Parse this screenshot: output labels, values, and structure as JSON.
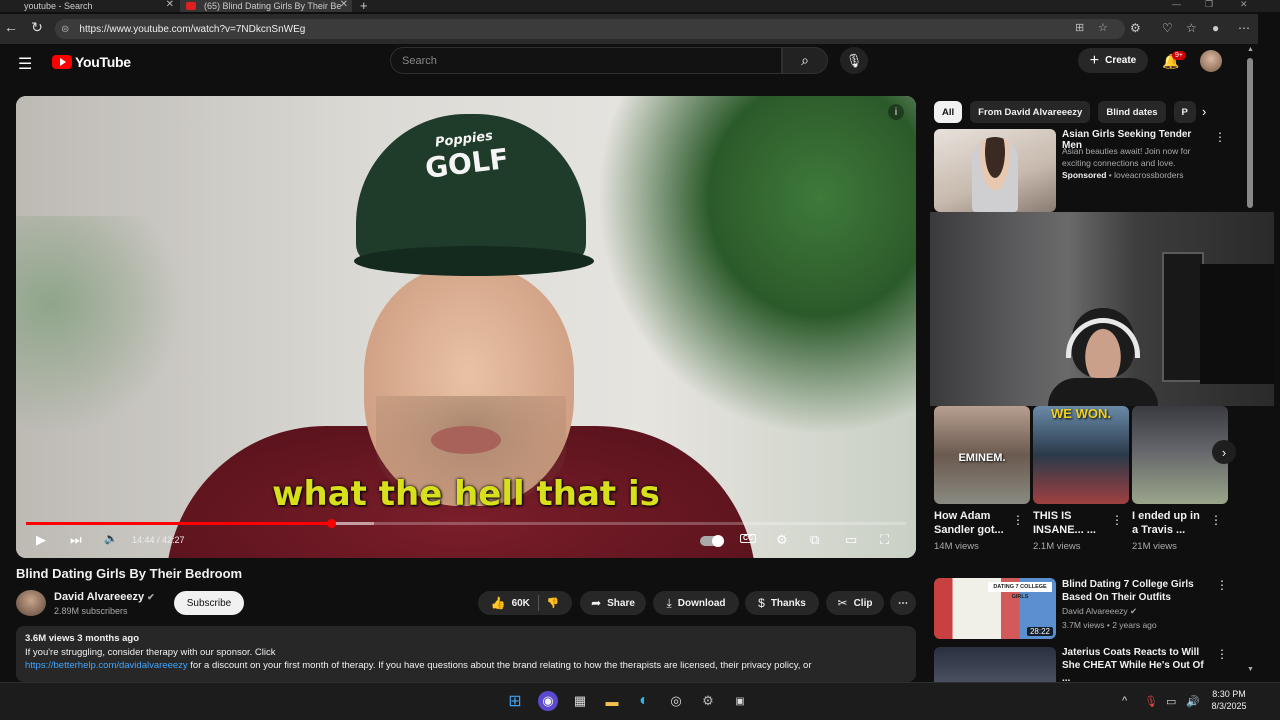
{
  "browser": {
    "tabs": [
      {
        "label": "youtube - Search"
      },
      {
        "label": "(65) Blind Dating Girls By Their Be"
      }
    ],
    "url": "https://www.youtube.com/watch?v=7NDkcnSnWEg"
  },
  "header": {
    "logo_text": "YouTube",
    "search_placeholder": "Search",
    "create_label": "Create",
    "notification_badge": "9+"
  },
  "player": {
    "subtitle": "what the hell that is",
    "cap_logo_top": "Poppies",
    "cap_logo_main": "GOLF",
    "current_time": "14:44",
    "duration": "42:27",
    "time_display": "14:44 / 42:27",
    "progress_fraction": 0.347,
    "buffered_fraction": 0.395
  },
  "video": {
    "title": "Blind Dating Girls By Their Bedroom",
    "channel_name": "David Alvareeezy",
    "subscribers": "2.89M subscribers",
    "subscribe_label": "Subscribe",
    "likes": "60K",
    "share_label": "Share",
    "download_label": "Download",
    "thanks_label": "Thanks",
    "clip_label": "Clip"
  },
  "description": {
    "meta": "3.6M views  3 months ago",
    "line1": "If you're struggling, consider therapy with our sponsor. Click",
    "link": "https://betterhelp.com/davidalvareeezy",
    "line2": " for a discount on your first month of therapy. If you have questions about the brand relating to how the therapists are licensed, their privacy policy, or"
  },
  "sidebar": {
    "chips": [
      "All",
      "From David Alvareeezy",
      "Blind dates",
      "P"
    ],
    "ad": {
      "title": "Asian Girls Seeking Tender Men",
      "desc": "Asian beauties await! Join now for exciting connections and love.",
      "sponsored": "Sponsored",
      "advertiser": "loveacrossborders"
    },
    "shorts": [
      {
        "title": "How Adam Sandler got...",
        "views": "14M views",
        "overlay": "EMINEM."
      },
      {
        "title": "THIS IS INSANE... ...",
        "views": "2.1M views",
        "overlay": "WE WON."
      },
      {
        "title": "I ended up in a Travis ...",
        "views": "21M views",
        "overlay": ""
      }
    ],
    "recs": [
      {
        "title": "Blind Dating 7 College Girls Based On Their Outfits",
        "channel": "David Alvareeezy",
        "meta": "3.7M views • 2 years ago",
        "duration": "28:22",
        "banner": "DATING 7 COLLEGE GIRLS"
      },
      {
        "title": "Jaterius Coats Reacts to Will She CHEAT While He's Out Of ..."
      }
    ]
  },
  "taskbar": {
    "time": "8:30 PM",
    "date": "8/3/2025"
  }
}
